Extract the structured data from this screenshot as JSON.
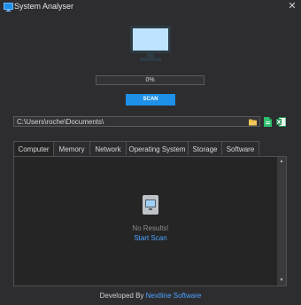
{
  "window": {
    "title": "System Analyser",
    "close_glyph": "✕",
    "icon": "monitor-icon"
  },
  "progress": {
    "text": "0%",
    "value_percent": 0,
    "color": "#007acc"
  },
  "scan_button": {
    "label": "SCAN",
    "color": "#1e90e8"
  },
  "path": {
    "value": "C:\\Users\\roche\\Documents\\"
  },
  "toolbar_icons": [
    "folder-icon",
    "document-icon",
    "excel-icon"
  ],
  "tabs": [
    {
      "label": "Computer",
      "active": true
    },
    {
      "label": "Memory",
      "active": false
    },
    {
      "label": "Network",
      "active": false
    },
    {
      "label": "Operating System",
      "active": false
    },
    {
      "label": "Storage",
      "active": false
    },
    {
      "label": "Software",
      "active": false
    }
  ],
  "panel": {
    "empty_message": "No Results!",
    "start_link": "Start Scan"
  },
  "footer": {
    "prefix": "Developed By ",
    "link": "Nextline Software"
  },
  "colors": {
    "background": "#2d2d30",
    "panel": "#252526",
    "accent": "#4aa3ff"
  }
}
